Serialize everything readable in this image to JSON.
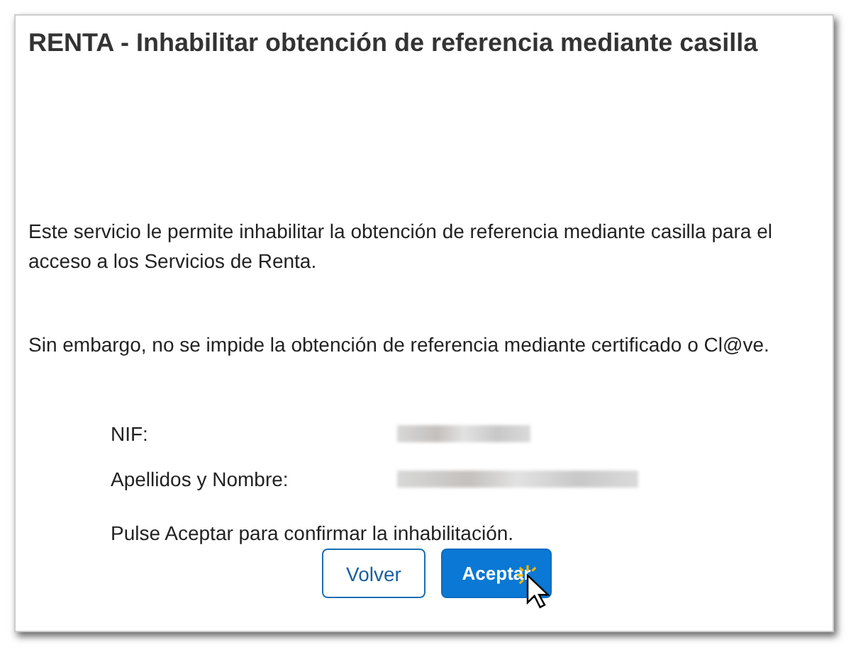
{
  "dialog": {
    "title": "RENTA - Inhabilitar obtención de referencia mediante casilla"
  },
  "paragraphs": [
    "Este servicio le permite inhabilitar la obtención de referencia mediante casilla para el acceso a los Servicios de Renta.",
    "Sin embargo, no se impide la obtención de referencia mediante certificado o Cl@ve."
  ],
  "fields": [
    {
      "label": "NIF:",
      "kind": "redacted"
    },
    {
      "label": "Apellidos y Nombre:",
      "kind": "redacted"
    }
  ],
  "prompt": "Pulse Aceptar para confirmar la inhabilitación.",
  "buttons": [
    {
      "label": "Volver",
      "kind": "secondary"
    },
    {
      "label": "Aceptar",
      "kind": "primary"
    }
  ]
}
